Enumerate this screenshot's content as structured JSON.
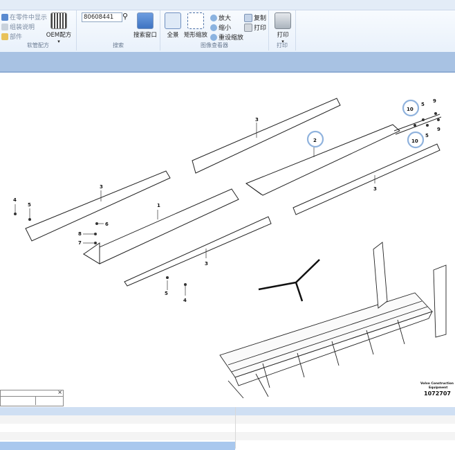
{
  "toolbar": {
    "parts_group": {
      "items": [
        "在零件中显示",
        "组装说明",
        "部件"
      ],
      "label": "软管配方",
      "oem_button": "OEM配方"
    },
    "search_group": {
      "value": "80608441",
      "button": "搜索窗口",
      "label": "搜索"
    },
    "image_group": {
      "fullview": "全景",
      "rect_zoom": "矩形缩放",
      "zoom_in": "放大",
      "zoom_out": "缩小",
      "reset_zoom": "重设缩放",
      "copy": "复制",
      "print_small": "打印",
      "label": "图像查看器"
    },
    "print_group": {
      "button": "打印",
      "label": "打印"
    }
  },
  "diagram": {
    "callouts": [
      "1",
      "2",
      "3",
      "3",
      "3",
      "3",
      "4",
      "4",
      "5",
      "5",
      "5",
      "5",
      "6",
      "7",
      "8",
      "9",
      "9",
      "10",
      "10"
    ],
    "brand_line1": "Volvo Construction",
    "brand_line2": "Equipment",
    "figure_number": "1072707"
  },
  "colors": {
    "ribbon": "#e9f1fb",
    "header_bar": "#a8c2e3",
    "callout_ring": "#8fb2dd"
  }
}
